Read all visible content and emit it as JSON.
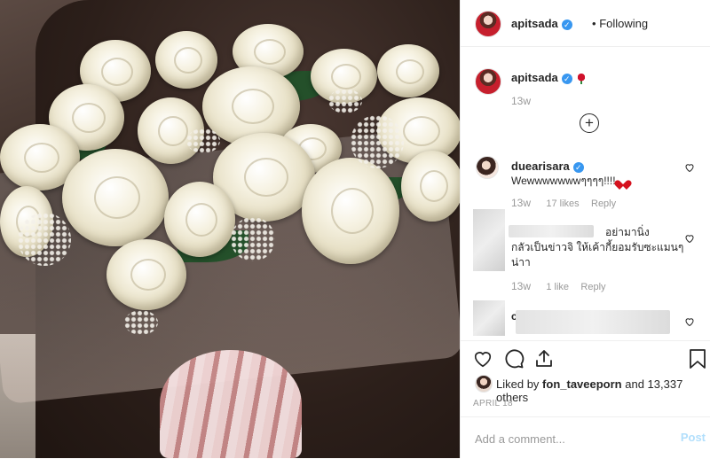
{
  "photo": {
    "alt": ""
  },
  "header": {
    "username": "apitsada",
    "separator": "•",
    "follow_label": "Following"
  },
  "caption": {
    "username": "apitsada",
    "time": "13w"
  },
  "comments": [
    {
      "username": "duearisara",
      "text": "Wewwwwwwwๆๆๆๆ!!!!",
      "time": "13w",
      "likes": "17 likes",
      "reply": "Reply"
    },
    {
      "username": "",
      "text_line1": "อย่ามานิ่ง",
      "text_line2": "กลัวเป็นข่าวจิ ให้เค้ากี้ยอมรับซะแมนๆ",
      "text_line3": "น่าา",
      "time": "13w",
      "likes": "1 like",
      "reply": "Reply"
    },
    {
      "username": "c"
    }
  ],
  "actions": {
    "liked_by_prefix": "Liked by",
    "liked_by_user": "fon_taveeporn",
    "liked_by_suffix": "and 13,337 others",
    "date": "APRIL 18"
  },
  "add_comment": {
    "placeholder": "Add a comment...",
    "post_label": "Post"
  },
  "colors": {
    "verified": "#3897f0",
    "post_disabled": "#b2dffc",
    "muted": "#999999",
    "text": "#262626"
  },
  "icons": {
    "verified": "verified-badge-icon",
    "like": "heart-icon",
    "comment": "comment-bubble-icon",
    "share": "share-icon",
    "save": "bookmark-icon",
    "load_more": "plus-circle-icon"
  }
}
